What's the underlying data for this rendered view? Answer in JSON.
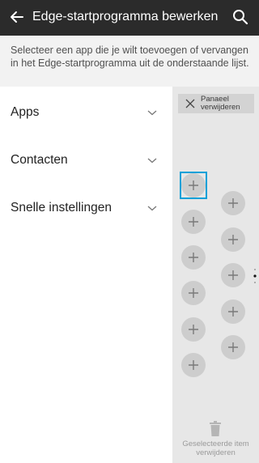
{
  "header": {
    "title": "Edge-startprogramma bewerken",
    "back_icon": "arrow-left-icon",
    "search_icon": "search-icon"
  },
  "instruction": "Selecteer een app die je wilt toevoegen of vervangen in het Edge-startprogramma uit de onderstaande lijst.",
  "categories": [
    {
      "label": "Apps"
    },
    {
      "label": "Contacten"
    },
    {
      "label": "Snelle instellingen"
    }
  ],
  "panel": {
    "remove_panel_label": "Panaeel verwijderen",
    "delete_selected_label": "Geselecteerde item verwijderen",
    "slot_count_column_1": 6,
    "slot_count_column_2": 5
  },
  "colors": {
    "app_bar": "#2b2b2b",
    "panel_bg": "#e7e7e7",
    "selected_border": "#00a0d8"
  }
}
